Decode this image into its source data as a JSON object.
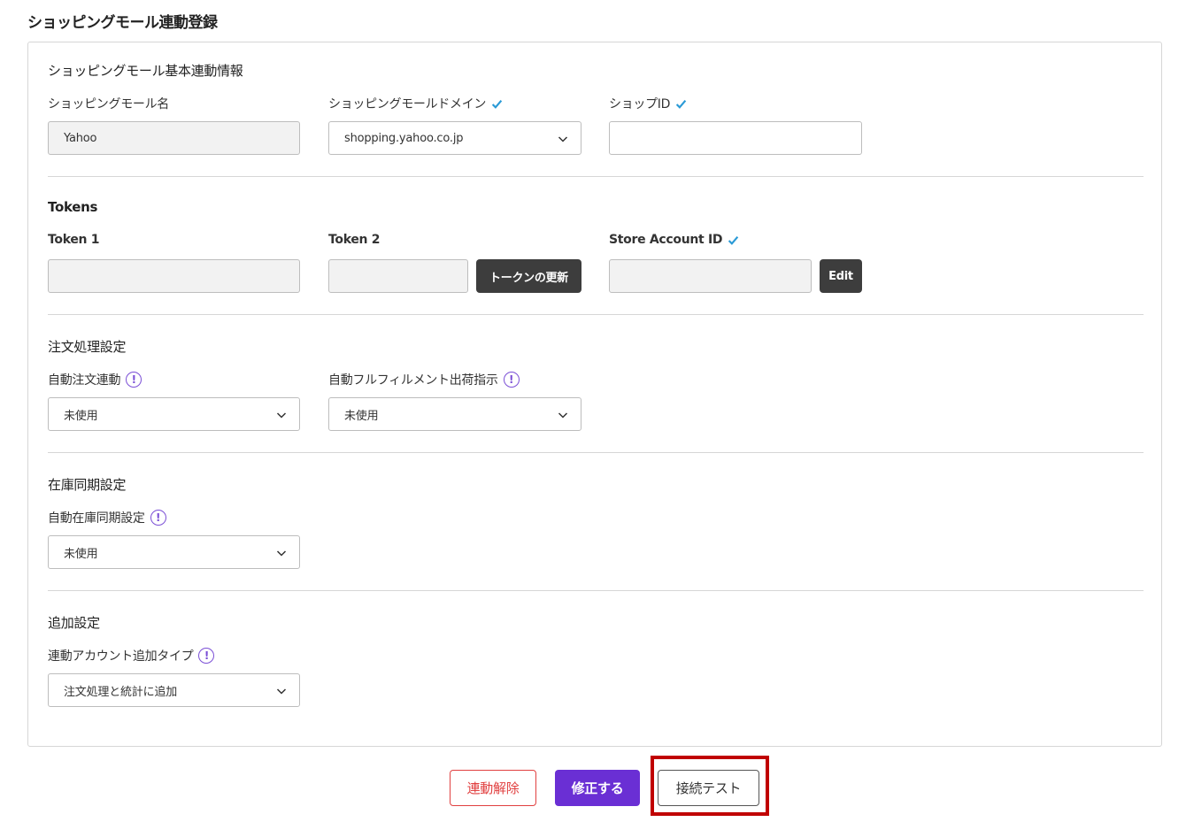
{
  "page_title": "ショッピングモール連動登録",
  "basic": {
    "section_title": "ショッピングモール基本連動情報",
    "mall_name_label": "ショッピングモール名",
    "mall_name_value": "Yahoo",
    "domain_label": "ショッピングモールドメイン",
    "domain_value": "shopping.yahoo.co.jp",
    "shop_id_label": "ショップID",
    "shop_id_value": ""
  },
  "tokens": {
    "section_title": "Tokens",
    "token1_label": "Token 1",
    "token1_value": "",
    "token2_label": "Token 2",
    "token2_value": "",
    "refresh_token_button": "トークンの更新",
    "store_account_label": "Store Account ID",
    "store_account_value": "",
    "edit_button": "Edit"
  },
  "order": {
    "section_title": "注文処理設定",
    "auto_order_label": "自動注文連動",
    "auto_order_value": "未使用",
    "auto_fulfillment_label": "自動フルフィルメント出荷指示",
    "auto_fulfillment_value": "未使用"
  },
  "inventory": {
    "section_title": "在庫同期設定",
    "auto_sync_label": "自動在庫同期設定",
    "auto_sync_value": "未使用"
  },
  "additional": {
    "section_title": "追加設定",
    "account_type_label": "連動アカウント追加タイプ",
    "account_type_value": "注文処理と統計に追加"
  },
  "actions": {
    "unlink_label": "連動解除",
    "modify_label": "修正する",
    "test_label": "接続テスト"
  },
  "colors": {
    "accent_purple": "#6a2fd4",
    "danger_red": "#e14040",
    "check_blue": "#2a9ad6",
    "highlight_red": "#c00000"
  },
  "icons": {
    "check": "check-icon",
    "info": "info-icon",
    "dropdown": "chevron-down-icon"
  }
}
